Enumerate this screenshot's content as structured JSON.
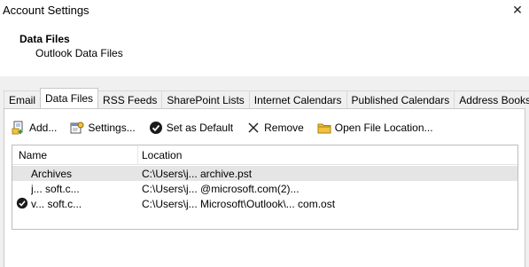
{
  "window": {
    "title": "Account Settings",
    "close_glyph": "✕"
  },
  "header": {
    "title": "Data Files",
    "subtitle": "Outlook Data Files"
  },
  "tabs": [
    {
      "label": "Email",
      "active": false
    },
    {
      "label": "Data Files",
      "active": true
    },
    {
      "label": "RSS Feeds",
      "active": false
    },
    {
      "label": "SharePoint Lists",
      "active": false
    },
    {
      "label": "Internet Calendars",
      "active": false
    },
    {
      "label": "Published Calendars",
      "active": false
    },
    {
      "label": "Address Books",
      "active": false
    }
  ],
  "toolbar": {
    "add": {
      "label": "Add...",
      "icon": "add-file-icon"
    },
    "settings": {
      "label": "Settings...",
      "icon": "settings-icon"
    },
    "set_default": {
      "label": "Set as Default",
      "icon": "checkmark-circle-icon"
    },
    "remove": {
      "label": "Remove",
      "icon": "close-x-icon"
    },
    "open_location": {
      "label": "Open File Location...",
      "icon": "folder-icon"
    }
  },
  "list": {
    "columns": [
      "Name",
      "Location"
    ],
    "rows": [
      {
        "name": "Archives",
        "location": "C:\\Users\\j... archive.pst",
        "selected": true,
        "default": false
      },
      {
        "name": "j... soft.c...",
        "location": "C:\\Users\\j... @microsoft.com(2)...",
        "selected": false,
        "default": false
      },
      {
        "name": "v... soft.c...",
        "location": "C:\\Users\\j... Microsoft\\Outlook\\... com.ost",
        "selected": false,
        "default": true
      }
    ]
  },
  "colors": {
    "selected_row": "#e5e5e5",
    "panel_bg": "#f0f0f0",
    "check_default": "#000000"
  }
}
